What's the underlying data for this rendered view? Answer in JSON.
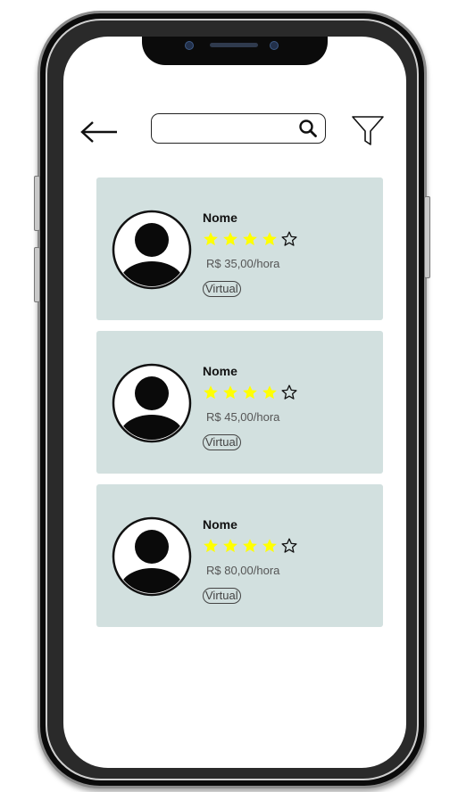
{
  "search": {
    "placeholder": "",
    "icon": "search-icon"
  },
  "nav": {
    "back_icon": "arrow-left-icon",
    "filter_icon": "filter-icon"
  },
  "colors": {
    "card_bg": "#d2e0df",
    "star_filled": "#ffff00",
    "text": "#111111"
  },
  "results": [
    {
      "name": "Nome",
      "rating": 4,
      "max_rating": 5,
      "price": "R$ 35,00/hora",
      "mode": "Virtual"
    },
    {
      "name": "Nome",
      "rating": 4,
      "max_rating": 5,
      "price": "R$ 45,00/hora",
      "mode": "Virtual"
    },
    {
      "name": "Nome",
      "rating": 4,
      "max_rating": 5,
      "price": "R$ 80,00/hora",
      "mode": "Virtual"
    }
  ]
}
